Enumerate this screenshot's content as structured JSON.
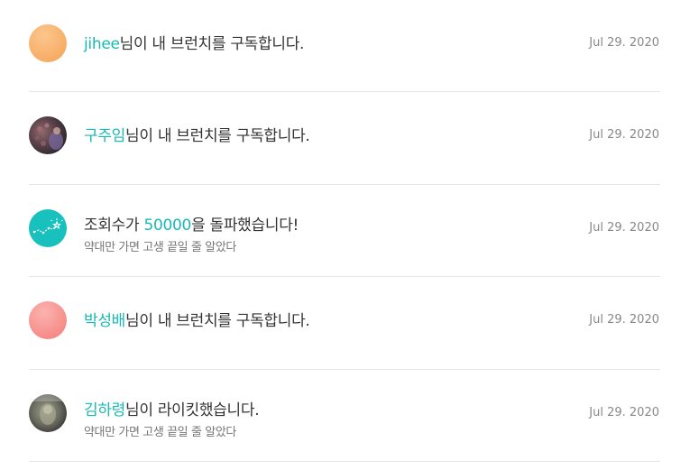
{
  "notifications": [
    {
      "name": "jihee",
      "message": "님이 내 브런치를 구독합니다.",
      "date": "Jul 29. 2020",
      "avatar": "orange-avatar"
    },
    {
      "name": "구주임",
      "message": "님이 내 브런치를 구독합니다.",
      "date": "Jul 29. 2020",
      "avatar": "photo-avatar"
    },
    {
      "prefix": "조회수가 ",
      "count": "50000",
      "suffix": "을 돌파했습니다!",
      "subtitle": "약대만 가면 고생 끝일 줄 알았다",
      "date": "Jul 29. 2020",
      "avatar": "stats-icon"
    },
    {
      "name": "박성배",
      "message": "님이 내 브런치를 구독합니다.",
      "date": "Jul 29. 2020",
      "avatar": "pink-avatar"
    },
    {
      "name": "김하령",
      "message": "님이 라이킷했습니다.",
      "subtitle": "약대만 가면 고생 끝일 줄 알았다",
      "date": "Jul 29. 2020",
      "avatar": "photo-avatar"
    }
  ],
  "colors": {
    "highlight": "#19b9b6",
    "text": "#333333",
    "subtext": "#777777",
    "divider": "#e6e6e6"
  }
}
